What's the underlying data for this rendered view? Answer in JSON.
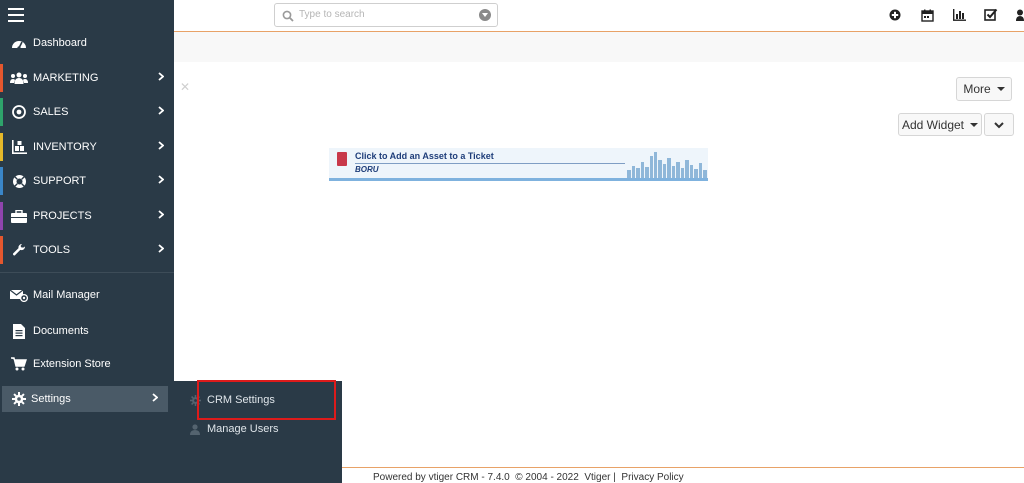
{
  "search": {
    "placeholder": "Type to search"
  },
  "header_icons": [
    "add-icon",
    "calendar-icon",
    "reports-icon",
    "tasks-icon",
    "user-icon"
  ],
  "toolbar": {
    "more_label": "More",
    "add_widget_label": "Add Widget"
  },
  "banner": {
    "title": "Click to Add an Asset to a Ticket",
    "logo_text": "BORU"
  },
  "sidebar": {
    "items": [
      {
        "label": "Dashboard",
        "icon": "dashboard-icon",
        "accent": "",
        "chevron": ""
      },
      {
        "label": "MARKETING",
        "icon": "users-icon",
        "accent": "#e4572e",
        "chevron": "›"
      },
      {
        "label": "SALES",
        "icon": "target-icon",
        "accent": "#2ea36b",
        "chevron": "›"
      },
      {
        "label": "INVENTORY",
        "icon": "inventory-icon",
        "accent": "#e5b82a",
        "chevron": "›"
      },
      {
        "label": "SUPPORT",
        "icon": "lifebuoy-icon",
        "accent": "#3a86c8",
        "chevron": "›"
      },
      {
        "label": "PROJECTS",
        "icon": "briefcase-icon",
        "accent": "#8e44ad",
        "chevron": "›"
      },
      {
        "label": "TOOLS",
        "icon": "wrench-icon",
        "accent": "#e4572e",
        "chevron": "›"
      },
      {
        "label": "Mail Manager",
        "icon": "mail-icon",
        "accent": "",
        "chevron": ""
      },
      {
        "label": "Documents",
        "icon": "document-icon",
        "accent": "",
        "chevron": ""
      },
      {
        "label": "Extension Store",
        "icon": "cart-icon",
        "accent": "",
        "chevron": ""
      },
      {
        "label": "Settings",
        "icon": "gear-icon",
        "accent": "",
        "chevron": "›"
      }
    ]
  },
  "submenu": {
    "items": [
      {
        "label": "CRM Settings",
        "icon": "gear-icon"
      },
      {
        "label": "Manage Users",
        "icon": "user-icon"
      }
    ]
  },
  "footer": {
    "text": "Powered by vtiger CRM - 7.4.0  © 2004 - 2022  Vtiger |  Privacy Policy"
  }
}
